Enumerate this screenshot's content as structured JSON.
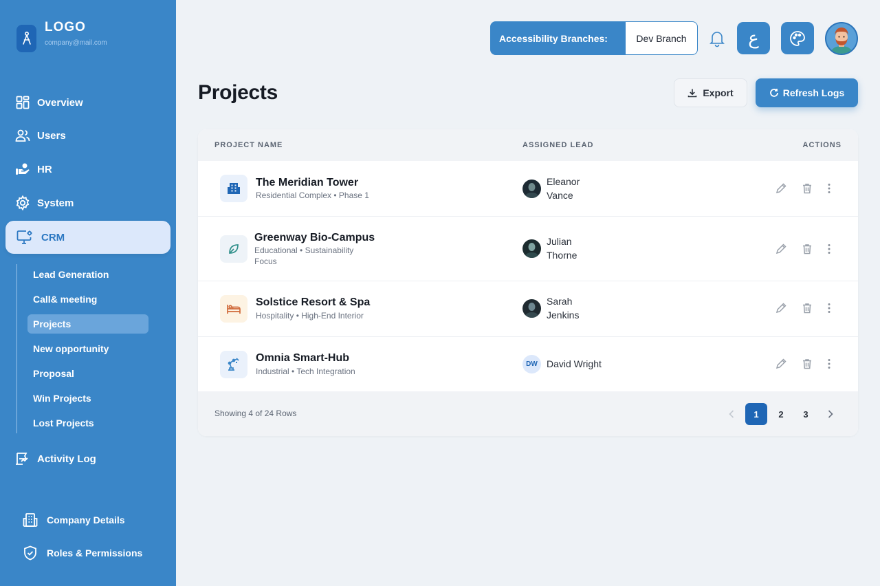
{
  "brand": {
    "title": "LOGO",
    "email": "company@mail.com"
  },
  "sidebar": {
    "items": [
      {
        "label": "Overview",
        "icon": "grid-icon"
      },
      {
        "label": "Users",
        "icon": "users-icon"
      },
      {
        "label": "HR",
        "icon": "hand-coin-icon"
      },
      {
        "label": "System",
        "icon": "gear-icon"
      }
    ],
    "active": {
      "label": "CRM",
      "icon": "monitor-gear-icon"
    },
    "sub_items": [
      "Lead Generation",
      "Call& meeting",
      "Projects",
      "New opportunity",
      "Proposal",
      "Win Projects",
      "Lost Projects"
    ],
    "activity": "Activity Log",
    "bottom": [
      {
        "label": "Company Details",
        "icon": "building-icon"
      },
      {
        "label": "Roles & Permissions",
        "icon": "shield-check-icon"
      }
    ]
  },
  "topbar": {
    "branch_label": "Accessibility Branches:",
    "branch_value": "Dev Branch",
    "lang_glyph": "ع"
  },
  "page": {
    "title": "Projects",
    "export_label": "Export",
    "refresh_label": "Refresh Logs"
  },
  "table": {
    "headers": {
      "name": "PROJECT NAME",
      "lead": "ASSIGNED LEAD",
      "actions": "ACTIONS"
    },
    "rows": [
      {
        "name": "The Meridian Tower",
        "sub": "Residential Complex • Phase 1",
        "lead": "Eleanor Vance",
        "lead_line1": "Eleanor",
        "lead_line2": "Vance",
        "icon": "building-icon"
      },
      {
        "name": "Greenway Bio-Campus",
        "sub_line1": "Educational • Sustainability",
        "sub_line2": "Focus",
        "lead_line1": "Julian",
        "lead_line2": "Thorne",
        "icon": "leaf-icon"
      },
      {
        "name": "Solstice Resort & Spa",
        "sub": "Hospitality • High-End Interior",
        "lead_line1": "Sarah",
        "lead_line2": "Jenkins",
        "icon": "bed-icon"
      },
      {
        "name": "Omnia Smart-Hub",
        "sub": "Industrial • Tech Integration",
        "lead": "David Wright",
        "initials": "DW",
        "icon": "robot-arm-icon"
      }
    ],
    "footer": "Showing 4 of 24 Rows",
    "pages": [
      "1",
      "2",
      "3"
    ],
    "current_page": "1"
  },
  "colors": {
    "primary": "#3a86c8",
    "dark_primary": "#1f66b5",
    "active_bg": "#dce8fb"
  }
}
